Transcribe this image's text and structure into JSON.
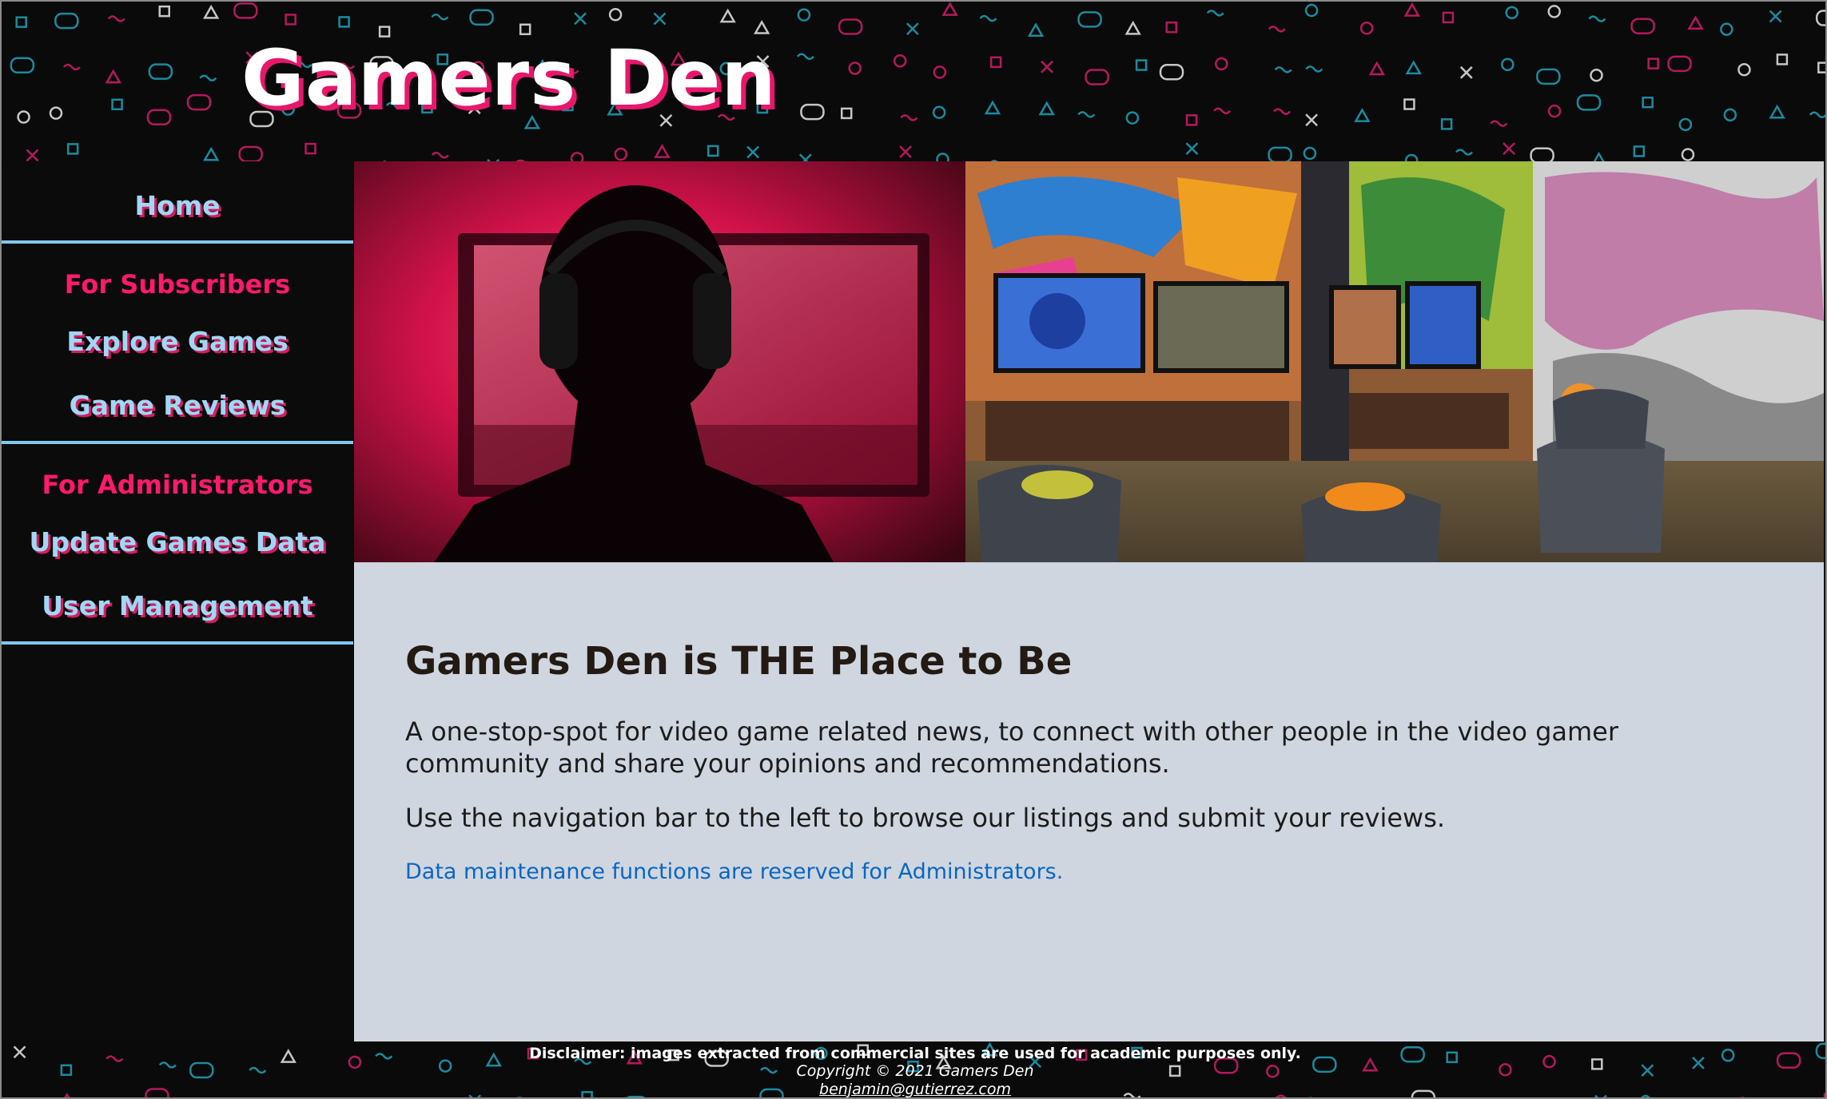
{
  "header": {
    "title": "Gamers Den"
  },
  "sidebar": {
    "home": "Home",
    "subscribers_heading": "For Subscribers",
    "explore_games": "Explore Games",
    "game_reviews": "Game Reviews",
    "administrators_heading": "For Administrators",
    "update_games_data": "Update Games Data",
    "user_management": "User Management"
  },
  "main": {
    "heading": "Gamers Den is THE Place to Be",
    "paragraph1": "A one-stop-spot for video game related news, to connect with other people in the video gamer community and share your opinions and recommendations.",
    "paragraph2": "Use the navigation bar to the left to browse our listings and submit your reviews.",
    "admin_note": "Data maintenance functions are reserved for Administrators."
  },
  "footer": {
    "disclaimer": "Disclaimer: images extracted from commercial sites are used for academic purposes only.",
    "copyright": "Copyright © 2021 Gamers Den",
    "email": "benjamin@gutierrez.com"
  },
  "images": {
    "hero_left": "gamer-silhouette-photo",
    "hero_right": "graffiti-gaming-lounge-photo"
  },
  "colors": {
    "accent_pink": "#ff1a6c",
    "link_blue": "#9fd8f5",
    "divider": "#7fc8ec",
    "content_bg": "#cfd6df",
    "admin_note": "#0a66c2"
  }
}
